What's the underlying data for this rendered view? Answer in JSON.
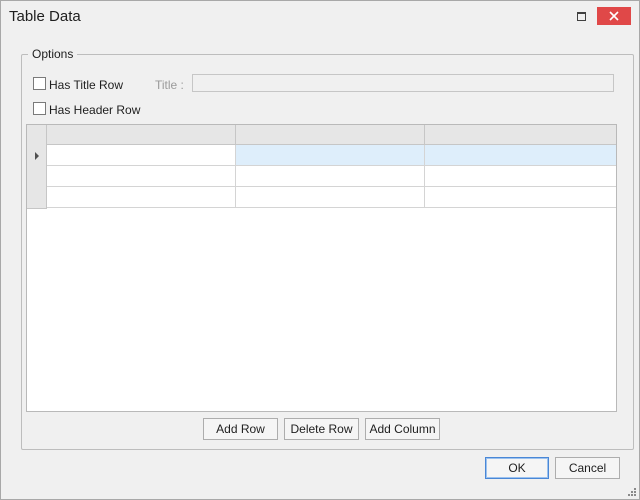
{
  "window": {
    "title": "Table Data"
  },
  "options": {
    "group_label": "Options",
    "has_title_row": {
      "label": "Has Title Row",
      "checked": false
    },
    "title_field": {
      "label": "Title :",
      "value": ""
    },
    "has_header_row": {
      "label": "Has Header Row",
      "checked": false
    }
  },
  "grid": {
    "columns": [
      "",
      "",
      ""
    ],
    "rows": [
      [
        "",
        "",
        ""
      ],
      [
        "",
        "",
        ""
      ],
      [
        "",
        "",
        ""
      ]
    ],
    "current_row": 0
  },
  "buttons": {
    "add_row": "Add Row",
    "delete_row": "Delete Row",
    "add_column": "Add Column",
    "ok": "OK",
    "cancel": "Cancel"
  },
  "colors": {
    "close": "#e04848",
    "selection": "#deeefb",
    "focus": "#4a87d6"
  },
  "icons": {
    "restore": "restore-icon",
    "close": "close-icon",
    "row_indicator": "row-indicator-icon",
    "resize": "resize-grip-icon"
  }
}
